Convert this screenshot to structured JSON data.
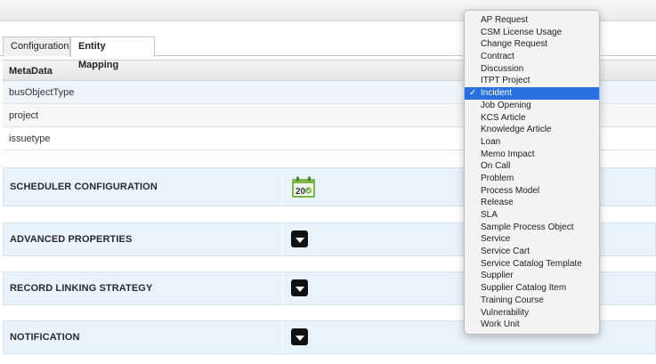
{
  "tabs": [
    {
      "label": "Configuration",
      "active": false
    },
    {
      "label": "Entity Mapping",
      "active": true
    }
  ],
  "metadata": {
    "header": "MetaData",
    "rows": [
      "busObjectType",
      "project",
      "issuetype"
    ]
  },
  "sections": [
    {
      "title": "SCHEDULER CONFIGURATION",
      "icon": "calendar-icon"
    },
    {
      "title": "ADVANCED PROPERTIES",
      "icon": "dropdown-toggle-icon"
    },
    {
      "title": "RECORD LINKING STRATEGY",
      "icon": "dropdown-toggle-icon"
    },
    {
      "title": "NOTIFICATION",
      "icon": "dropdown-toggle-icon"
    }
  ],
  "calendar_number": "20",
  "dropdown": {
    "selected": "Incident",
    "check_mark": "✓",
    "options": [
      "AP Request",
      "CSM License Usage",
      "Change Request",
      "Contract",
      "Discussion",
      "ITPT Project",
      "Incident",
      "Job Opening",
      "KCS Article",
      "Knowledge Article",
      "Loan",
      "Memo Impact",
      "On Call",
      "Problem",
      "Process Model",
      "Release",
      "SLA",
      "Sample Process Object",
      "Service",
      "Service Cart",
      "Service Catalog Template",
      "Supplier",
      "Supplier Catalog Item",
      "Training Course",
      "Vulnerability",
      "Work Unit"
    ]
  },
  "colors": {
    "selection": "#2a6fe0",
    "section_bg": "#e9f3fb",
    "calendar_green": "#7ab648"
  }
}
